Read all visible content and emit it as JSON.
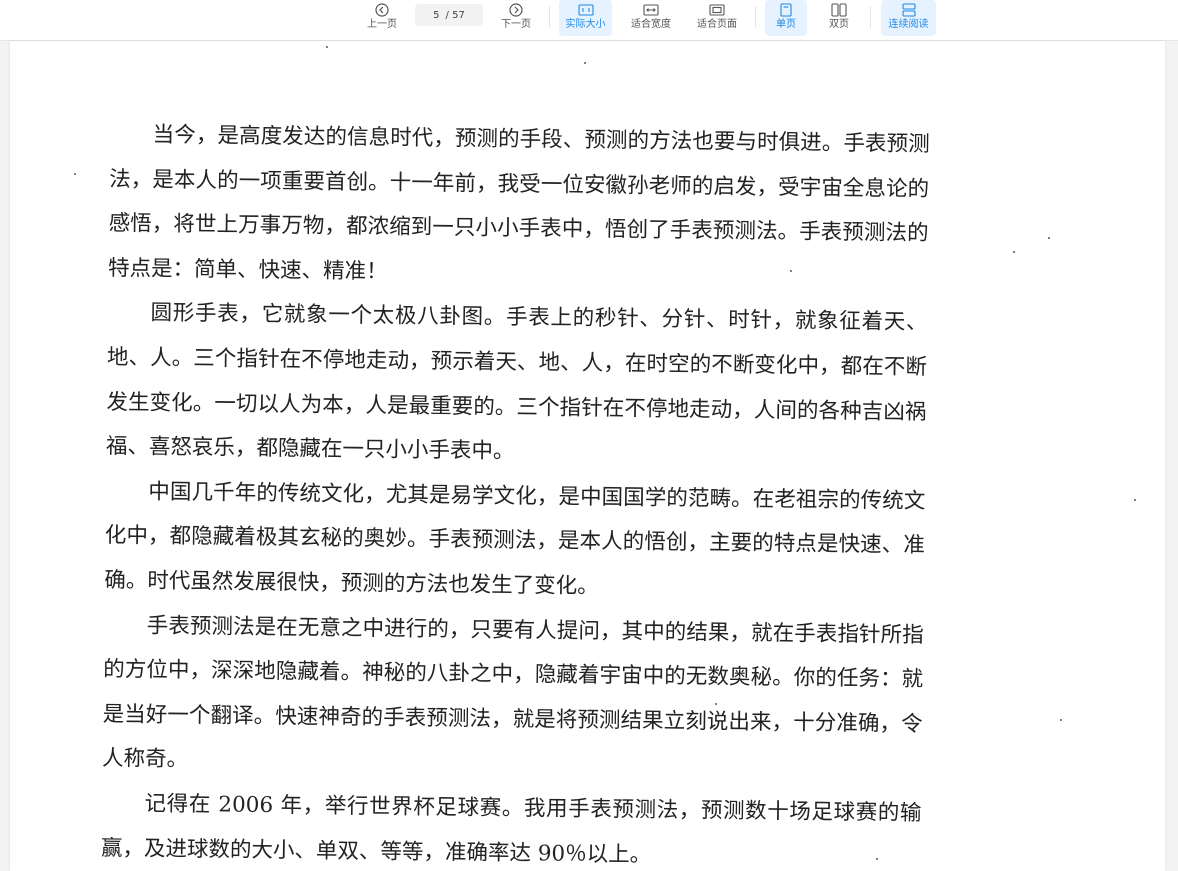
{
  "toolbar": {
    "prev_label": "上一页",
    "next_label": "下一页",
    "current_page": "5",
    "total_pages": "/ 57",
    "actual_size_label": "实际大小",
    "fit_width_label": "适合宽度",
    "fit_page_label": "适合页面",
    "single_page_label": "单页",
    "double_page_label": "双页",
    "continuous_label": "连续阅读",
    "accent_color": "#1e88e5"
  },
  "document": {
    "paragraphs": [
      "当今，是高度发达的信息时代，预测的手段、预测的方法也要与时俱进。手表预测法，是本人的一项重要首创。十一年前，我受一位安徽孙老师的启发，受宇宙全息论的感悟，将世上万事万物，都浓缩到一只小小手表中，悟创了手表预测法。手表预测法的特点是：简单、快速、精准！",
      "圆形手表，它就象一个太极八卦图。手表上的秒针、分针、时针，就象征着天、地、人。三个指针在不停地走动，预示着天、地、人，在时空的不断变化中，都在不断发生变化。一切以人为本，人是最重要的。三个指针在不停地走动，人间的各种吉凶祸福、喜怒哀乐，都隐藏在一只小小手表中。",
      "中国几千年的传统文化，尤其是易学文化，是中国国学的范畴。在老祖宗的传统文化中，都隐藏着极其玄秘的奥妙。手表预测法，是本人的悟创，主要的特点是快速、准确。时代虽然发展很快，预测的方法也发生了变化。",
      "手表预测法是在无意之中进行的，只要有人提问，其中的结果，就在手表指针所指的方位中，深深地隐藏着。神秘的八卦之中，隐藏着宇宙中的无数奥秘。你的任务：就是当好一个翻译。快速神奇的手表预测法，就是将预测结果立刻说出来，十分准确，令人称奇。",
      "记得在 2006 年，举行世界杯足球赛。我用手表预测法，预测数十场足球赛的输赢，及进球数的大小、单双、等等，准确率达 90％以上。"
    ]
  }
}
